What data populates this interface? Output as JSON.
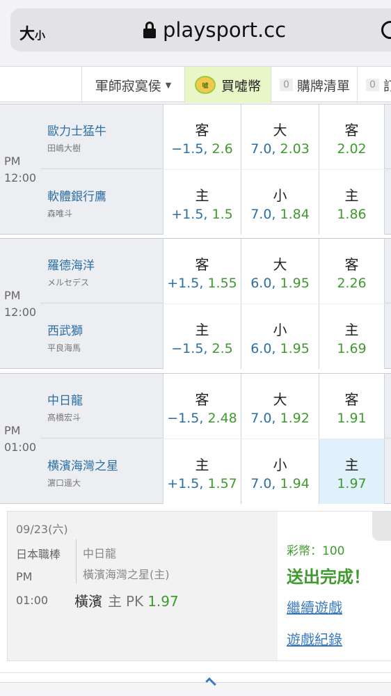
{
  "browser": {
    "text_size_big": "大",
    "text_size_small": "小",
    "url": "playsport.cc"
  },
  "toolbar": {
    "judge_label": "軍師寂寞侯",
    "buy_label": "買噓幣",
    "coin_icon_text": "噓",
    "list_count": "0",
    "list_label": "購牌清單",
    "rec_count": "0",
    "rec_label": "訂"
  },
  "games": [
    {
      "time_ampm": "PM",
      "time": "12:00",
      "away": {
        "team": "歐力士猛牛",
        "pitcher": "田嶋大樹",
        "spread_side": "客",
        "spread_line": "−1.5,",
        "spread_odds": "2.6",
        "total_side": "大",
        "total_line": "7.0,",
        "total_odds": "2.03",
        "ml_side": "客",
        "ml_odds": "2.02"
      },
      "home": {
        "team": "軟體銀行鷹",
        "pitcher": "森唯斗",
        "spread_side": "主",
        "spread_line": "+1.5,",
        "spread_odds": "1.5",
        "total_side": "小",
        "total_line": "7.0,",
        "total_odds": "1.84",
        "ml_side": "主",
        "ml_odds": "1.86"
      }
    },
    {
      "time_ampm": "PM",
      "time": "12:00",
      "away": {
        "team": "羅德海洋",
        "pitcher": "メルセデス",
        "spread_side": "客",
        "spread_line": "+1.5,",
        "spread_odds": "1.55",
        "total_side": "大",
        "total_line": "6.0,",
        "total_odds": "1.95",
        "ml_side": "客",
        "ml_odds": "2.26"
      },
      "home": {
        "team": "西武獅",
        "pitcher": "平良海馬",
        "spread_side": "主",
        "spread_line": "−1.5,",
        "spread_odds": "2.5",
        "total_side": "小",
        "total_line": "6.0,",
        "total_odds": "1.95",
        "ml_side": "主",
        "ml_odds": "1.69"
      }
    },
    {
      "time_ampm": "PM",
      "time": "01:00",
      "away": {
        "team": "中日龍",
        "pitcher": "髙橋宏斗",
        "spread_side": "客",
        "spread_line": "−1.5,",
        "spread_odds": "2.48",
        "total_side": "大",
        "total_line": "7.0,",
        "total_odds": "1.92",
        "ml_side": "客",
        "ml_odds": "1.91"
      },
      "home": {
        "team": "横濱海灣之星",
        "pitcher": "濵口遥大",
        "spread_side": "主",
        "spread_line": "+1.5,",
        "spread_odds": "1.57",
        "total_side": "小",
        "total_line": "7.0,",
        "total_odds": "1.94",
        "ml_side": "主",
        "ml_odds": "1.97"
      }
    }
  ],
  "confirmation": {
    "date": "09/23(六)",
    "league": "日本職棒",
    "ampm": "PM",
    "time": "01:00",
    "away_team": "中日龍",
    "home_team": "橫濱海灣之星(主)",
    "pick_team": "橫濱",
    "pick_side": "主",
    "pick_type": "PK",
    "pick_odds": "1.97",
    "coins_text": "彩幣：100",
    "status": "送出完成！",
    "continue_link": "繼續遊戲",
    "record_link": "遊戲紀錄"
  },
  "colors": {
    "team_blue": "#2b6fa6",
    "odds_green": "#3f9a2f",
    "selected_cell": "#e1f1fb",
    "buy_highlight": "#e9f6c8"
  }
}
